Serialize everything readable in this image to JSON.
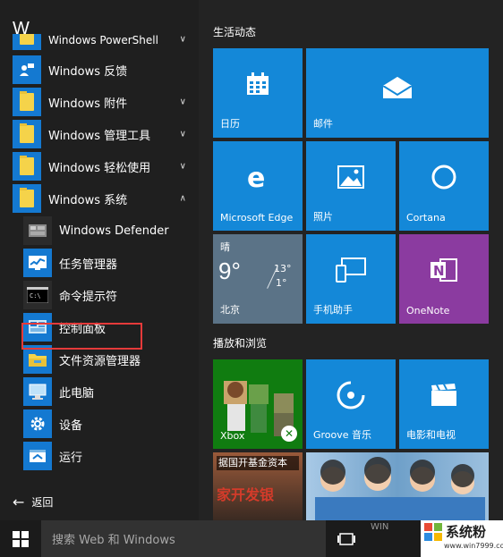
{
  "letter": "W",
  "apps": [
    {
      "label": "Windows PowerShell",
      "chevron": "∨",
      "icon": "folder-icon"
    },
    {
      "label": "Windows 反馈",
      "icon": "feedback-icon"
    },
    {
      "label": "Windows 附件",
      "chevron": "∨",
      "icon": "folder-icon"
    },
    {
      "label": "Windows 管理工具",
      "chevron": "∨",
      "icon": "folder-icon"
    },
    {
      "label": "Windows 轻松使用",
      "chevron": "∨",
      "icon": "folder-icon"
    },
    {
      "label": "Windows 系统",
      "chevron": "∧",
      "icon": "folder-icon"
    }
  ],
  "system_apps": [
    {
      "label": "Windows Defender",
      "icon": "defender-icon"
    },
    {
      "label": "任务管理器",
      "icon": "task-manager-icon"
    },
    {
      "label": "命令提示符",
      "icon": "command-prompt-icon"
    },
    {
      "label": "控制面板",
      "icon": "control-panel-icon"
    },
    {
      "label": "文件资源管理器",
      "icon": "file-explorer-icon"
    },
    {
      "label": "此电脑",
      "icon": "this-pc-icon"
    },
    {
      "label": "设备",
      "icon": "gear-icon"
    },
    {
      "label": "运行",
      "icon": "run-icon"
    }
  ],
  "back_label": "返回",
  "sections": {
    "live": "生活动态",
    "play": "播放和浏览"
  },
  "tiles": {
    "calendar": "日历",
    "mail": "邮件",
    "edge": "Microsoft Edge",
    "photos": "照片",
    "cortana": "Cortana",
    "weather": {
      "condition": "晴",
      "temp": "9°",
      "high": "13°",
      "low": "1°",
      "city": "北京"
    },
    "phone": "手机助手",
    "onenote": "OneNote",
    "xbox": "Xbox",
    "groove": "Groove 音乐",
    "movies": "电影和电视",
    "news": {
      "headline": "据国开基金资本",
      "headline2": "家开发银"
    }
  },
  "taskbar": {
    "search_placeholder": "搜索 Web 和 Windows"
  },
  "watermark": {
    "logo_text": "WIN",
    "text": "系统粉",
    "url": "www.win7999.com"
  },
  "colors": {
    "accent": "#1488d8",
    "highlight_box": "#e53a3a",
    "onenote": "#8b3ba0",
    "xbox": "#107c10",
    "weather": "#5b7387"
  }
}
